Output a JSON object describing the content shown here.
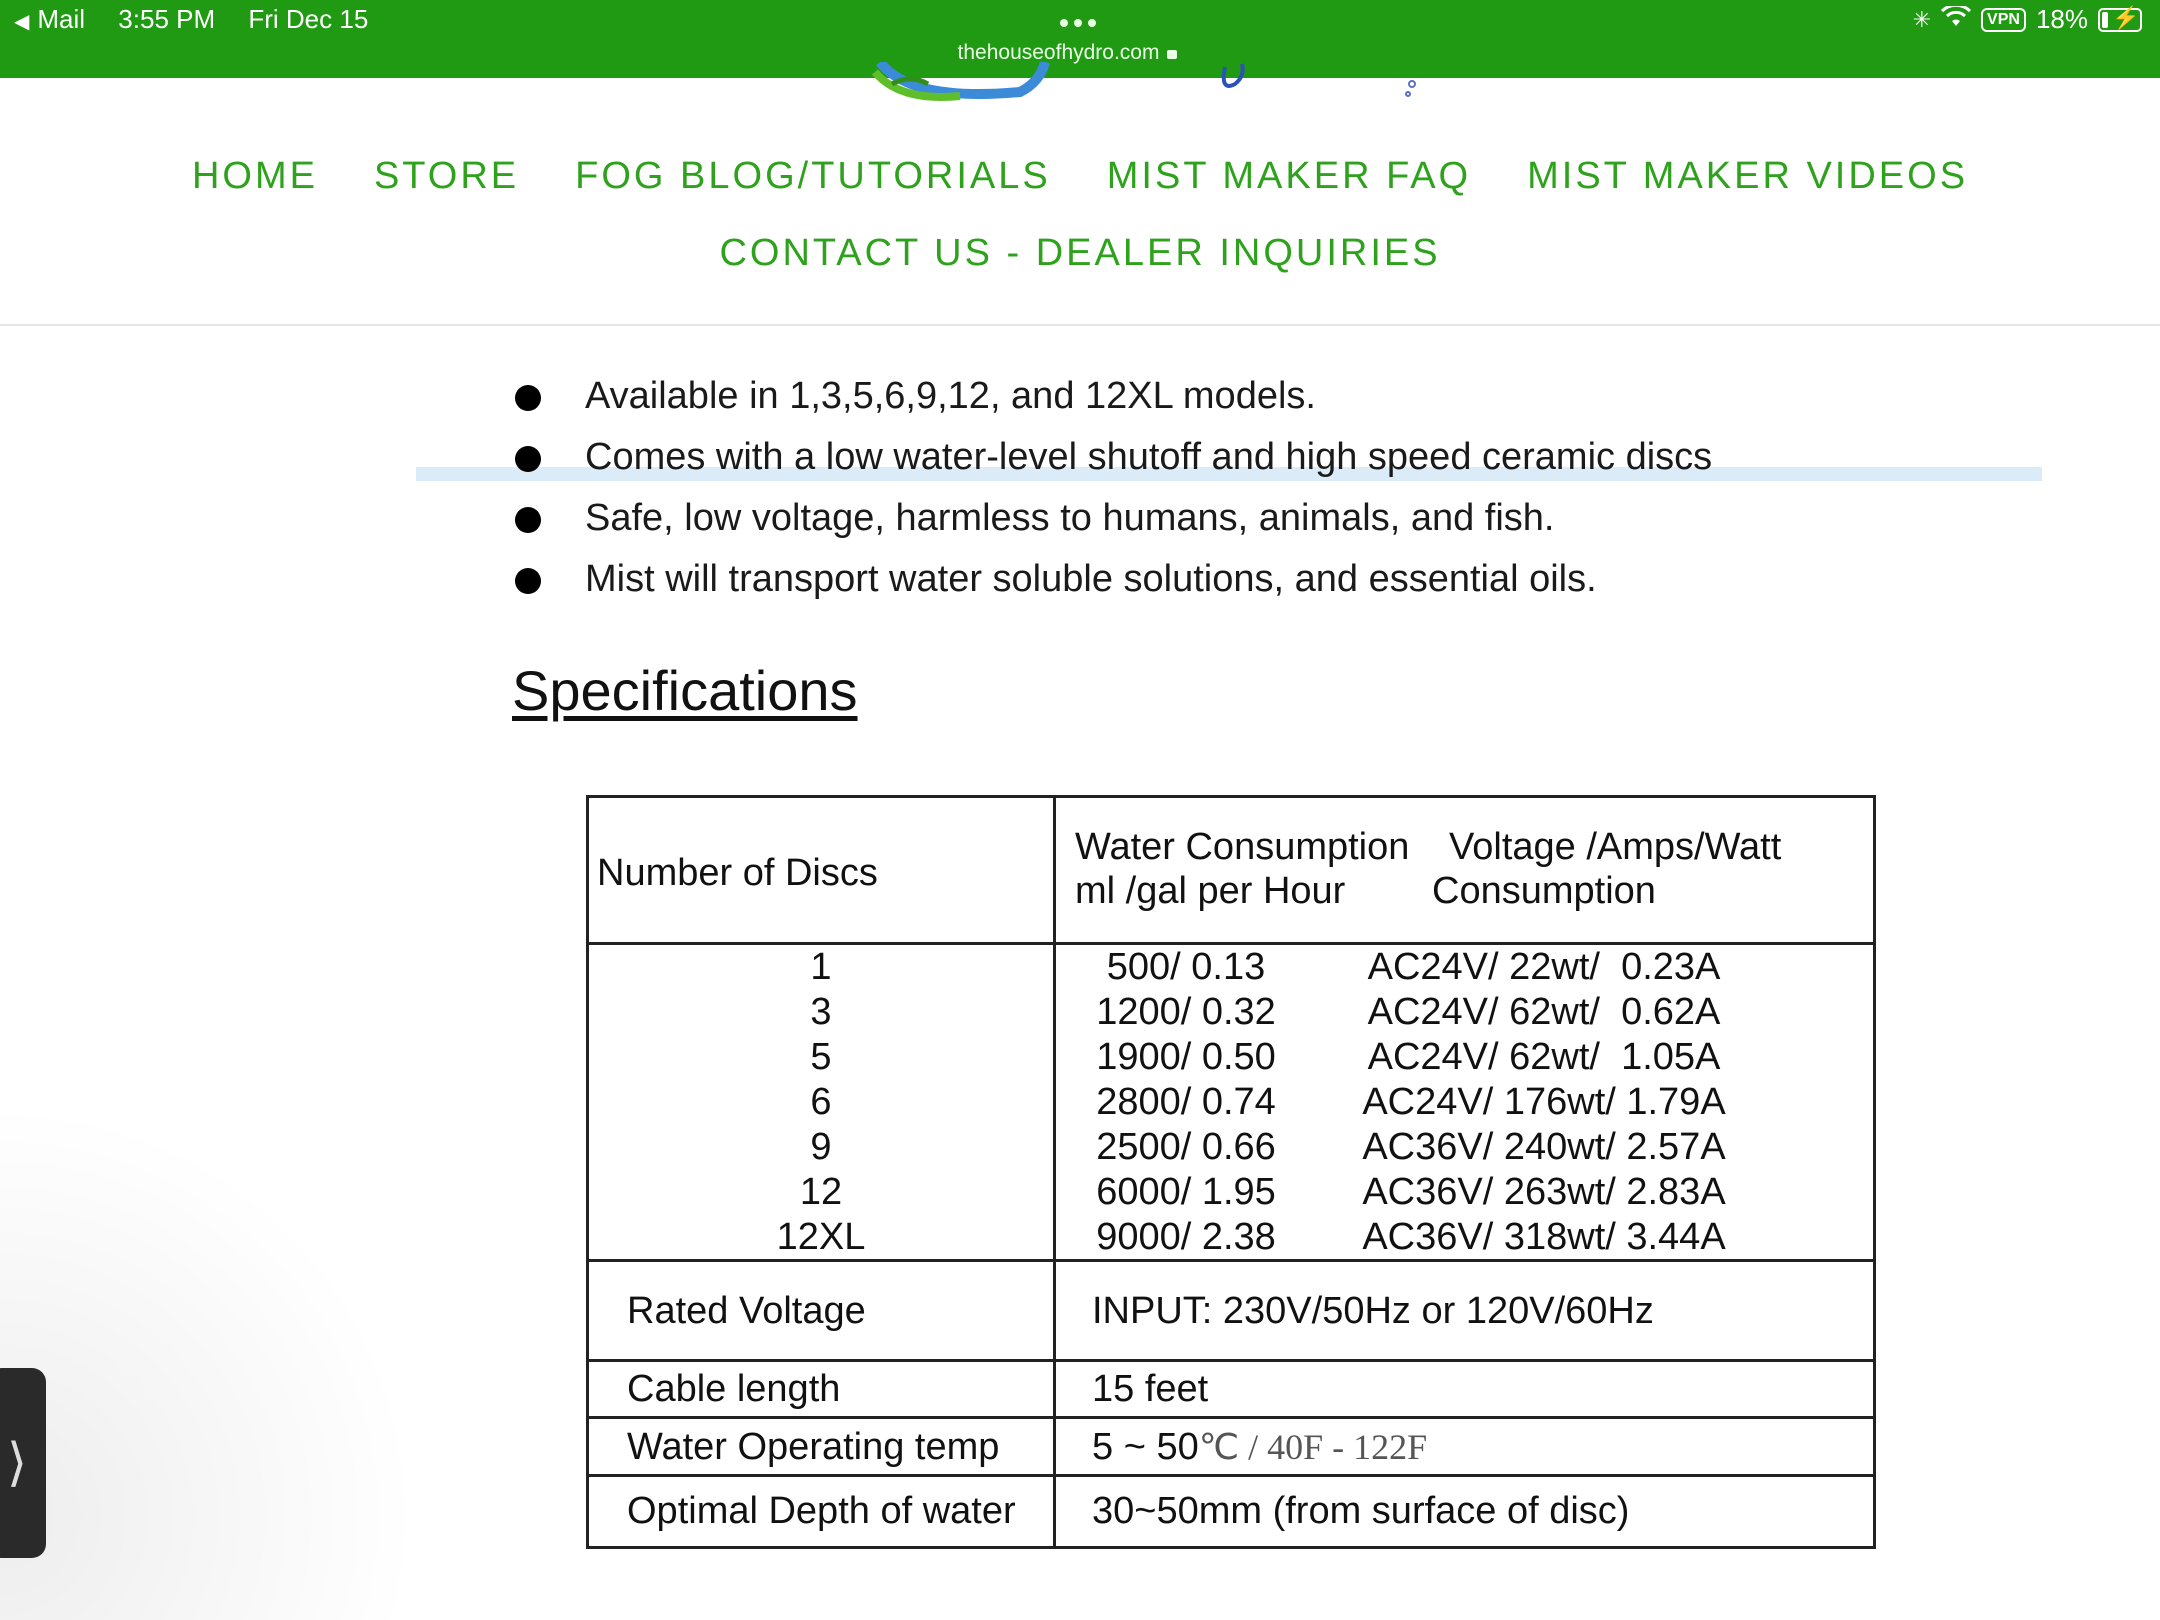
{
  "status_bar": {
    "back_app": "Mail",
    "time": "3:55 PM",
    "date": "Fri Dec 15",
    "vpn": "VPN",
    "battery": "18%",
    "battery_level": 0.18
  },
  "address_bar": {
    "url": "thehouseofhydro.com"
  },
  "nav": {
    "row1": [
      "HOME",
      "STORE",
      "FOG BLOG/TUTORIALS",
      "MIST MAKER FAQ",
      "MIST MAKER VIDEOS"
    ],
    "row2": [
      "CONTACT US - DEALER INQUIRIES"
    ]
  },
  "bullets": [
    "Available in 1,3,5,6,9,12, and 12XL models.",
    "Comes with a low water-level shutoff and high speed ceramic discs",
    "Safe, low voltage, harmless to humans, animals, and fish.",
    "Mist will transport water soluble solutions, and essential oils."
  ],
  "specifications": {
    "heading": "Specifications",
    "header": {
      "discs": "Number of Discs",
      "water_line1": "Water Consumption",
      "water_line2": "ml /gal per Hour",
      "power_line1": "Voltage /Amps/Watt",
      "power_line2": "Consumption"
    },
    "rows": [
      {
        "discs": "1",
        "water": "500/ 0.13",
        "power": "AC24V/ 22wt/  0.23A"
      },
      {
        "discs": "3",
        "water": "1200/ 0.32",
        "power": "AC24V/ 62wt/  0.62A"
      },
      {
        "discs": "5",
        "water": "1900/ 0.50",
        "power": "AC24V/ 62wt/  1.05A"
      },
      {
        "discs": "6",
        "water": "2800/ 0.74",
        "power": "AC24V/ 176wt/ 1.79A"
      },
      {
        "discs": "9",
        "water": "2500/ 0.66",
        "power": "AC36V/ 240wt/ 2.57A"
      },
      {
        "discs": "12",
        "water": "6000/ 1.95",
        "power": "AC36V/ 263wt/ 2.83A"
      },
      {
        "discs": "12XL",
        "water": "9000/ 2.38",
        "power": "AC36V/ 318wt/ 3.44A"
      }
    ],
    "rated_voltage_label": "Rated Voltage",
    "rated_voltage_value": "INPUT: 230V/50Hz or 120V/60Hz",
    "cable_label": "Cable length",
    "cable_value": "15 feet",
    "temp_label": "Water Operating temp",
    "temp_value_c": "5 ~ 50",
    "temp_value_f": "℃  /  40F  -  122F",
    "depth_label": "Optimal Depth of water",
    "depth_value": "30~50mm (from surface of disc)"
  },
  "side_tab": {
    "glyph": "⟩"
  },
  "colors": {
    "top_bar": "#1f9a12",
    "nav_link": "#2fa21d"
  }
}
